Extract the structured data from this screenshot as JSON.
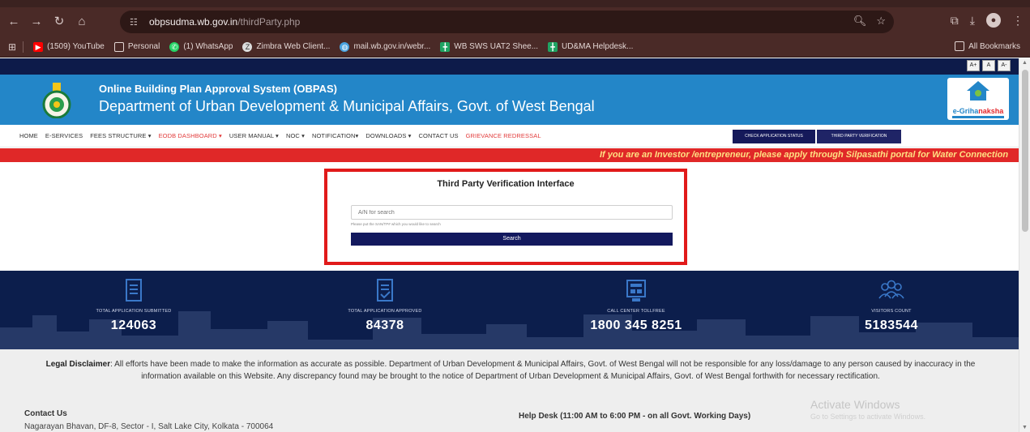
{
  "browser": {
    "url_host": "obpsudma.wb.gov.in",
    "url_path": "/thirdParty.php",
    "bookmarks": [
      {
        "label": "(1509) YouTube",
        "icon": "youtube-icon",
        "color": "#ff0000"
      },
      {
        "label": "Personal",
        "icon": "folder-icon",
        "color": ""
      },
      {
        "label": "(1) WhatsApp",
        "icon": "whatsapp-icon",
        "color": "#25d366"
      },
      {
        "label": "Zimbra Web Client...",
        "icon": "zimbra-icon",
        "color": "#dddddd"
      },
      {
        "label": "mail.wb.gov.in/webr...",
        "icon": "globe-icon",
        "color": "#4aa3df"
      },
      {
        "label": "WB SWS UAT2 Shee...",
        "icon": "sheets-icon",
        "color": "#1fa463"
      },
      {
        "label": "UD&MA Helpdesk...",
        "icon": "sheets-icon",
        "color": "#1fa463"
      }
    ],
    "all_bookmarks": "All Bookmarks"
  },
  "font_controls": [
    "A+",
    "A",
    "A-"
  ],
  "header": {
    "line1": "Online Building Plan Approval System (OBPAS)",
    "line2": "Department of Urban Development & Municipal Affairs, Govt. of West Bengal",
    "brand_prefix": "e-Griha",
    "brand_suffix": "naksha"
  },
  "menu": {
    "items": [
      {
        "label": "HOME",
        "red": false
      },
      {
        "label": "E-SERVICES",
        "red": false
      },
      {
        "label": "FEES STRUCTURE ▾",
        "red": false
      },
      {
        "label": "EODB DASHBOARD ▾",
        "red": true
      },
      {
        "label": "USER MANUAL ▾",
        "red": false
      },
      {
        "label": "NOC ▾",
        "red": false
      },
      {
        "label": "NOTIFICATION▾",
        "red": false
      },
      {
        "label": "DOWNLOADS ▾",
        "red": false
      },
      {
        "label": "CONTACT US",
        "red": false
      },
      {
        "label": "GRIEVANCE REDRESSAL",
        "red": true
      }
    ],
    "check_status": "CHECK APPLICATION STATUS",
    "third_party": "THIRD PARTY VERIFICATION"
  },
  "ticker": "If you are an Investor /entrepreneur, please apply through Silpasathi portal for Water Connection",
  "verify": {
    "title": "Third Party Verification Interface",
    "placeholder": "A/N for search",
    "hint": "Please put the SAN/TP# which you would like to search",
    "button": "Search"
  },
  "stats": [
    {
      "label": "TOTAL APPLICATION SUBMITTED",
      "value": "124063",
      "icon": "document-icon"
    },
    {
      "label": "TOTAL APPLICATION APPROVED",
      "value": "84378",
      "icon": "approved-document-icon"
    },
    {
      "label": "CALL CENTER TOLLFREE",
      "value": "1800 345 8251",
      "icon": "call-center-icon"
    },
    {
      "label": "VISITORS COUNT",
      "value": "5183544",
      "icon": "visitors-icon"
    }
  ],
  "disclaimer": {
    "lead": "Legal Disclaimer",
    "text": ": All efforts have been made to make the information as accurate as possible. Department of Urban Development & Municipal Affairs, Govt. of West Bengal will not be responsible for any loss/damage to any person caused by inaccuracy in the information available on this Website. Any discrepancy found may be brought to the notice of Department of Urban Development & Municipal Affairs, Govt. of West Bengal forthwith for necessary rectification."
  },
  "contact": {
    "title": "Contact Us",
    "address": "Nagarayan Bhavan, DF-8, Sector - I, Salt Lake City, Kolkata - 700064"
  },
  "helpdesk": {
    "title": "Help Desk (11:00 AM to 6:00 PM - on all Govt. Working Days)"
  },
  "watermark": {
    "line1": "Activate Windows",
    "line2": "Go to Settings to activate Windows."
  }
}
